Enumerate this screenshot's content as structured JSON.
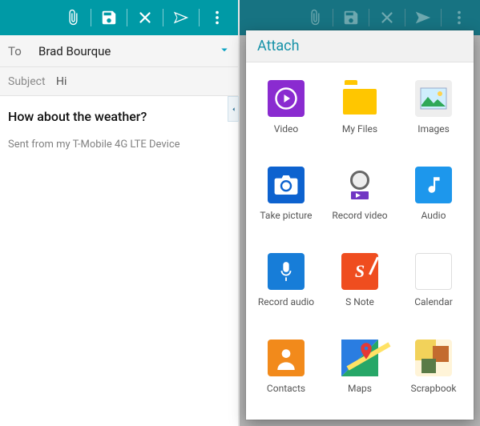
{
  "toolbar": {
    "attach_icon": "attach",
    "save_icon": "save",
    "discard_icon": "discard",
    "send_icon": "send",
    "overflow_icon": "more"
  },
  "compose": {
    "to_label": "To",
    "to_value": "Brad Bourque",
    "subject_label": "Subject",
    "subject_value": "Hi",
    "body": "How about the weather?",
    "signature": "Sent from my T-Mobile 4G LTE Device"
  },
  "attach": {
    "title": "Attach",
    "items": [
      {
        "label": "Video"
      },
      {
        "label": "My Files"
      },
      {
        "label": "Images"
      },
      {
        "label": "Take picture"
      },
      {
        "label": "Record video"
      },
      {
        "label": "Audio"
      },
      {
        "label": "Record audio"
      },
      {
        "label": "S Note"
      },
      {
        "label": "Calendar"
      },
      {
        "label": "Contacts"
      },
      {
        "label": "Maps"
      },
      {
        "label": "Scrapbook"
      }
    ]
  },
  "colors": {
    "teal": "#009aa6",
    "teal_dark": "#177382",
    "accent": "#0aa2c1"
  }
}
